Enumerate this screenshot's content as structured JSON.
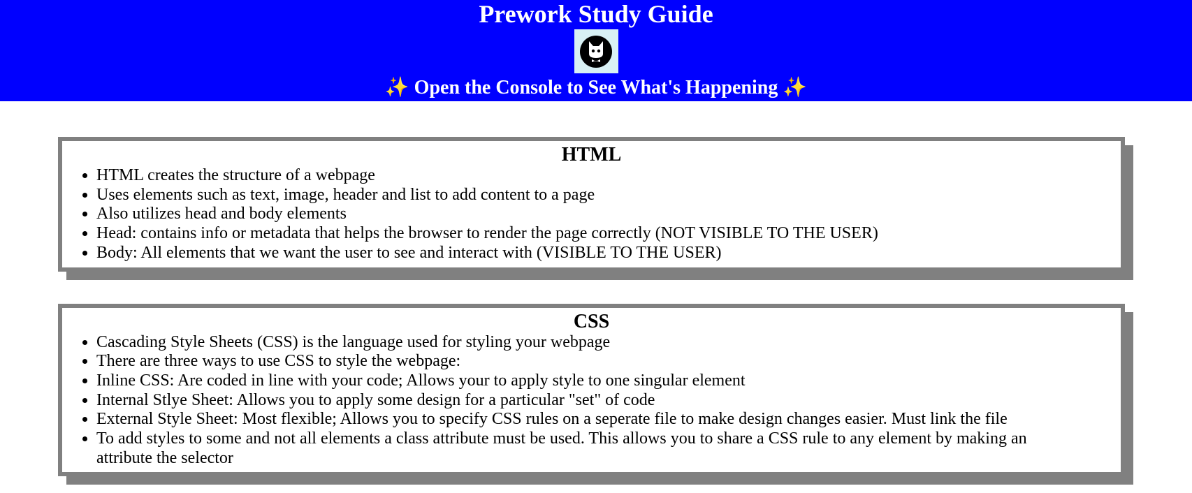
{
  "header": {
    "title": "Prework Study Guide",
    "subtitle": "✨ Open the Console to See What's Happening ✨",
    "logo_icon": "cat-icon",
    "background": "#0000ff"
  },
  "sections": [
    {
      "title": "HTML",
      "items": [
        "HTML creates the structure of a webpage",
        "Uses elements such as text, image, header and list to add content to a page",
        "Also utilizes head and body elements",
        "Head: contains info or metadata that helps the browser to render the page correctly (NOT VISIBLE TO THE USER)",
        "Body: All elements that we want the user to see and interact with (VISIBLE TO THE USER)"
      ]
    },
    {
      "title": "CSS",
      "items": [
        "Cascading Style Sheets (CSS) is the language used for styling your webpage",
        "There are three ways to use CSS to style the webpage:",
        "Inline CSS: Are coded in line with your code; Allows your to apply style to one singular element",
        "Internal Stlye Sheet: Allows you to apply some design for a particular \"set\" of code",
        "External Style Sheet: Most flexible; Allows you to specify CSS rules on a seperate file to make design changes easier. Must link the file",
        "To add styles to some and not all elements a class attribute must be used. This allows you to share a CSS rule to any element by making an attribute the selector"
      ]
    }
  ]
}
